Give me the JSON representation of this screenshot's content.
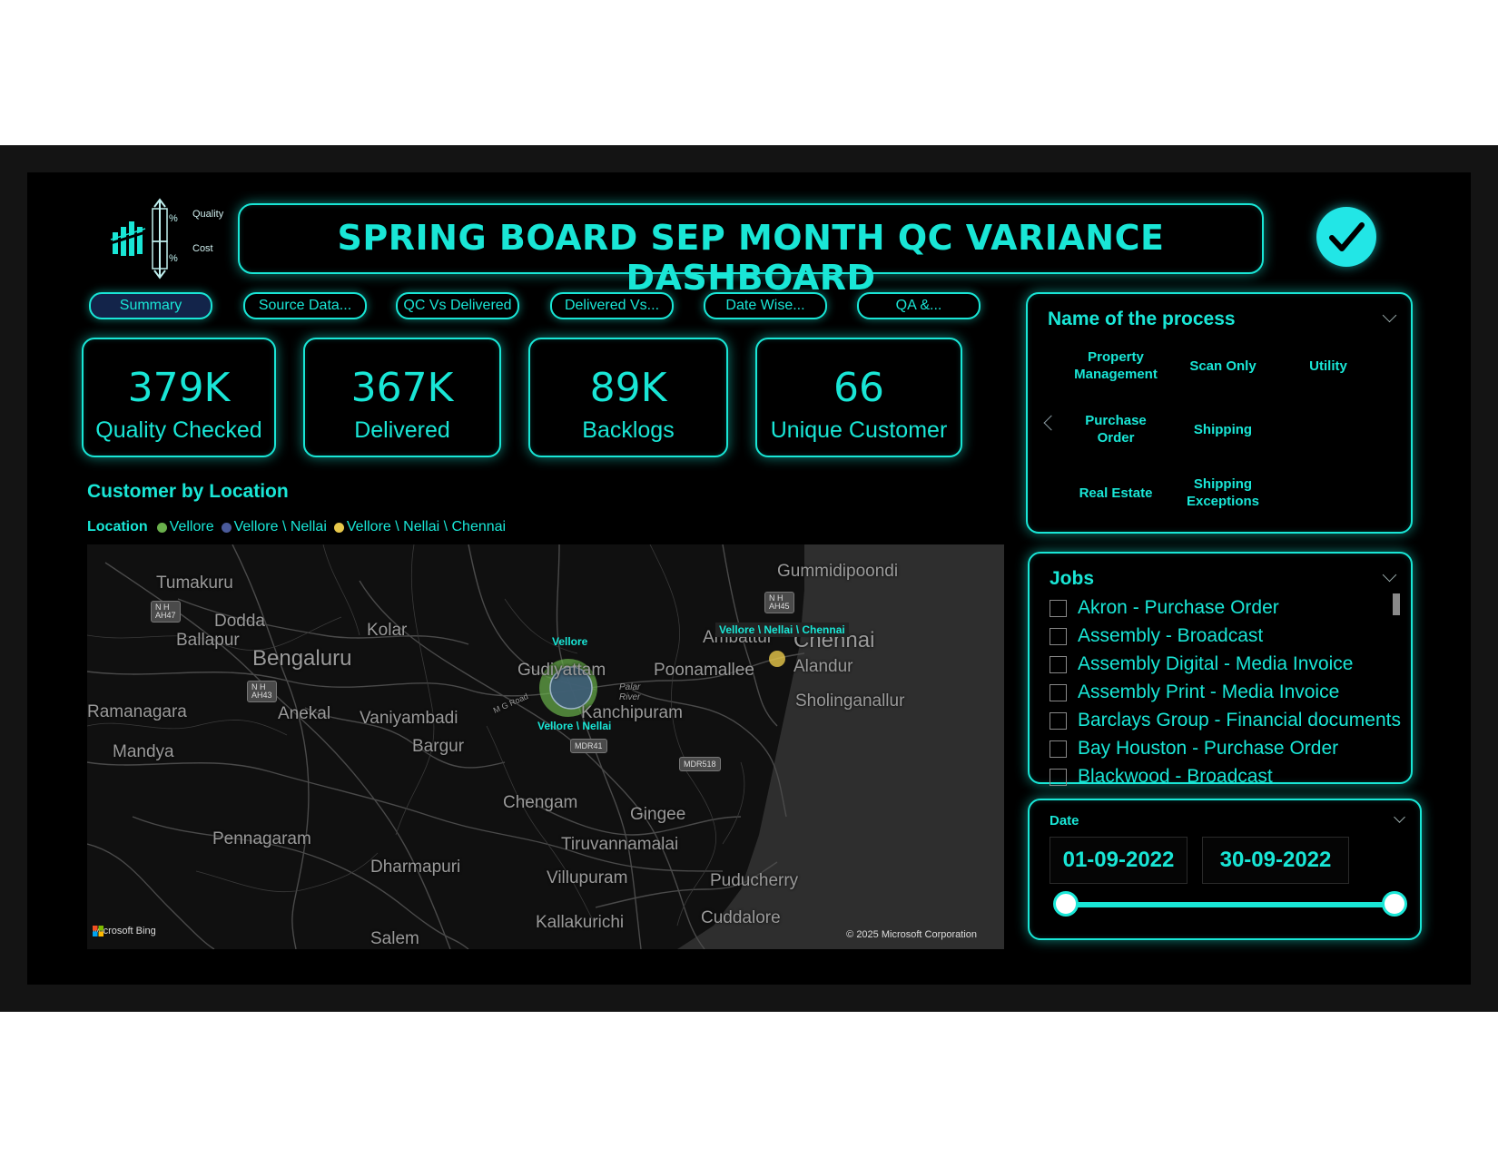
{
  "header": {
    "title": "SPRING BOARD SEP MONTH QC VARIANCE DASHBOARD",
    "logo_text": {
      "top": "Quality",
      "bottom": "Cost"
    },
    "check_icon": "checkmark-icon"
  },
  "tabs": [
    {
      "label": "Summary",
      "active": true
    },
    {
      "label": "Source Data..."
    },
    {
      "label": "QC Vs Delivered"
    },
    {
      "label": "Delivered Vs..."
    },
    {
      "label": "Date Wise..."
    },
    {
      "label": "QA &..."
    }
  ],
  "kpis": [
    {
      "value": "379K",
      "label": "Quality Checked"
    },
    {
      "value": "367K",
      "label": "Delivered"
    },
    {
      "value": "89K",
      "label": "Backlogs"
    },
    {
      "value": "66",
      "label": "Unique Customer"
    }
  ],
  "map": {
    "title": "Customer by Location",
    "legend_title": "Location",
    "legend": [
      {
        "label": "Vellore",
        "color": "#6ab04c"
      },
      {
        "label": "Vellore \\ Nellai",
        "color": "#4a5a9a"
      },
      {
        "label": "Vellore \\ Nellai \\ Chennai",
        "color": "#e8c84a"
      }
    ],
    "cities": [
      "Tumakuru",
      "Dodda",
      "Ballapur",
      "Kolar",
      "Bengaluru",
      "Ramanagara",
      "Anekal",
      "Vaniyambadi",
      "Mandya",
      "Bargur",
      "Gudiyattam",
      "Poonamallee",
      "Kanchipuram",
      "Gummidipoondi",
      "Ambattur",
      "Chennai",
      "Alandur",
      "Sholinganallur",
      "Chengam",
      "Gingee",
      "Pennagaram",
      "Tiruvannamalai",
      "Dharmapuri",
      "Villupuram",
      "Puducherry",
      "Kallakurichi",
      "Cuddalore",
      "Salem"
    ],
    "river": {
      "line1": "Palar",
      "line2": "River"
    },
    "road_text": "M G Road",
    "road_badges": [
      "N H\nAH47",
      "N H\nAH43",
      "N H\nAH45",
      "MDR41",
      "MDR518"
    ],
    "bubble_labels": [
      "Vellore",
      "Vellore \\ Nellai",
      "Vellore \\ Nellai \\ Chennai"
    ],
    "attribution": "Microsoft Bing",
    "copyright": "© 2025 Microsoft Corporation"
  },
  "process": {
    "title": "Name of the process",
    "items": [
      "Property Management",
      "Scan Only",
      "Utility",
      "Purchase Order",
      "Shipping",
      "Real Estate",
      "Shipping Exceptions"
    ]
  },
  "jobs": {
    "title": "Jobs",
    "items": [
      "Akron - Purchase Order",
      "Assembly - Broadcast",
      "Assembly Digital - Media Invoice",
      "Assembly Print - Media Invoice",
      "Barclays Group - Financial documents",
      "Bay Houston - Purchase Order",
      "Blackwood - Broadcast"
    ]
  },
  "date": {
    "label": "Date",
    "start": "01-09-2022",
    "end": "30-09-2022",
    "range_fraction": [
      0,
      1
    ]
  },
  "colors": {
    "accent": "#19e6d6",
    "background": "#000000"
  }
}
